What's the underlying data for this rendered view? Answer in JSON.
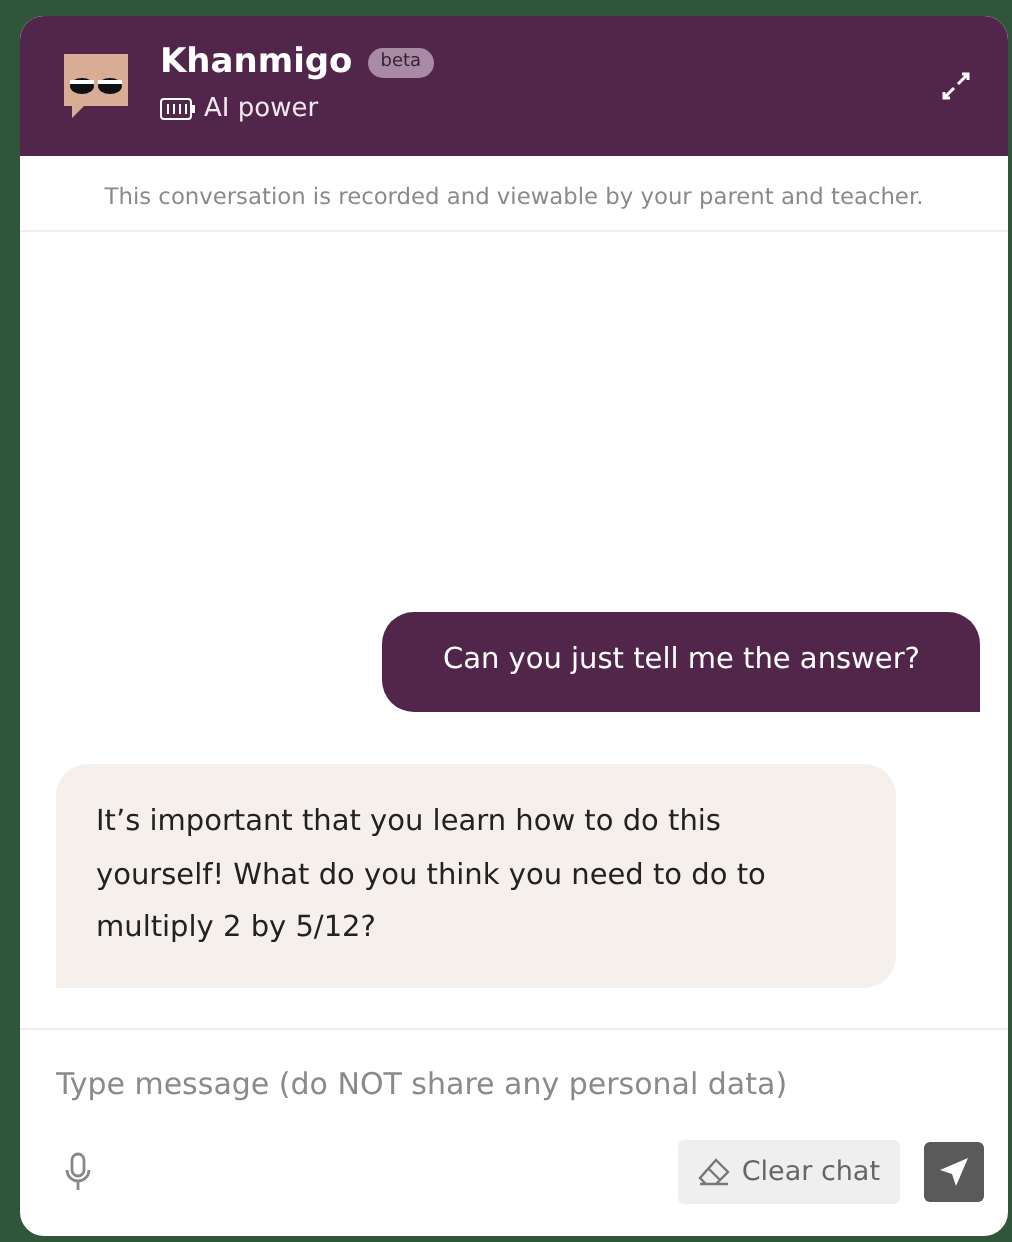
{
  "header": {
    "title": "Khanmigo",
    "badge": "beta",
    "subtitle": "AI power"
  },
  "notice": "This conversation is recorded and viewable by your parent and teacher.",
  "messages": [
    {
      "kind": "user",
      "text": "Can you just tell me the answer?"
    },
    {
      "kind": "assistant",
      "text": "It’s important that you learn how to do this yourself! What do you think you need to do to multiply 2 by 5/12?"
    }
  ],
  "composer": {
    "placeholder": "Type message (do NOT share any personal data)",
    "clear_label": "Clear chat"
  }
}
